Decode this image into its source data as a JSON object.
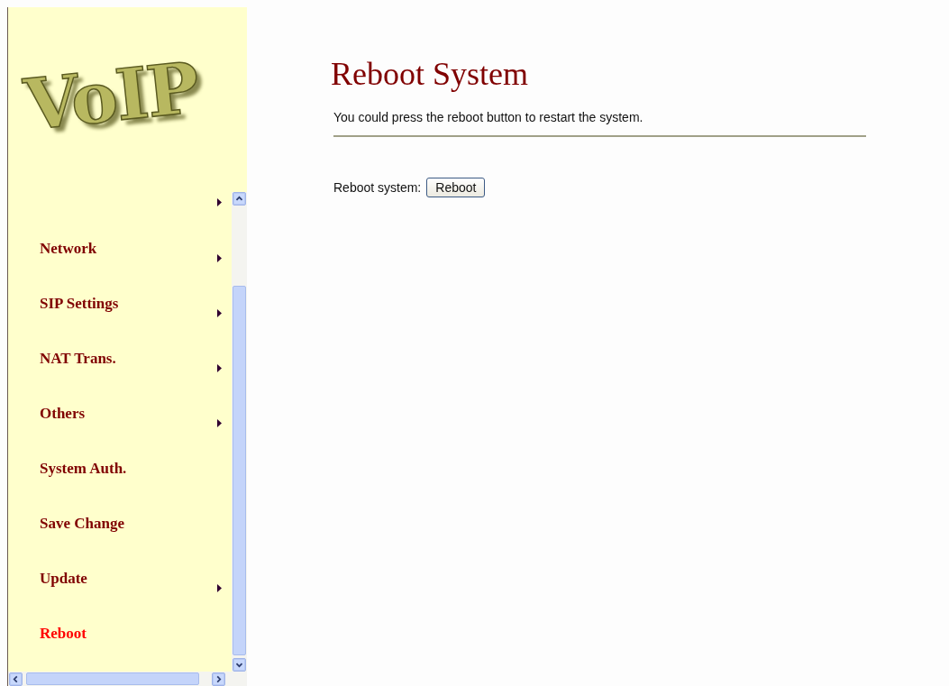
{
  "logo": {
    "text": "VoIP"
  },
  "sidebar": {
    "items": [
      {
        "label": "Network",
        "has_submenu": true,
        "selected": false
      },
      {
        "label": "SIP Settings",
        "has_submenu": true,
        "selected": false
      },
      {
        "label": "NAT Trans.",
        "has_submenu": true,
        "selected": false
      },
      {
        "label": "Others",
        "has_submenu": true,
        "selected": false
      },
      {
        "label": "System Auth.",
        "has_submenu": false,
        "selected": false
      },
      {
        "label": "Save Change",
        "has_submenu": false,
        "selected": false
      },
      {
        "label": "Update",
        "has_submenu": true,
        "selected": false
      },
      {
        "label": "Reboot",
        "has_submenu": false,
        "selected": true
      }
    ]
  },
  "page": {
    "title": "Reboot System",
    "description": "You could press the reboot button to restart the system.",
    "field_label": "Reboot system:",
    "button": "Reboot"
  }
}
